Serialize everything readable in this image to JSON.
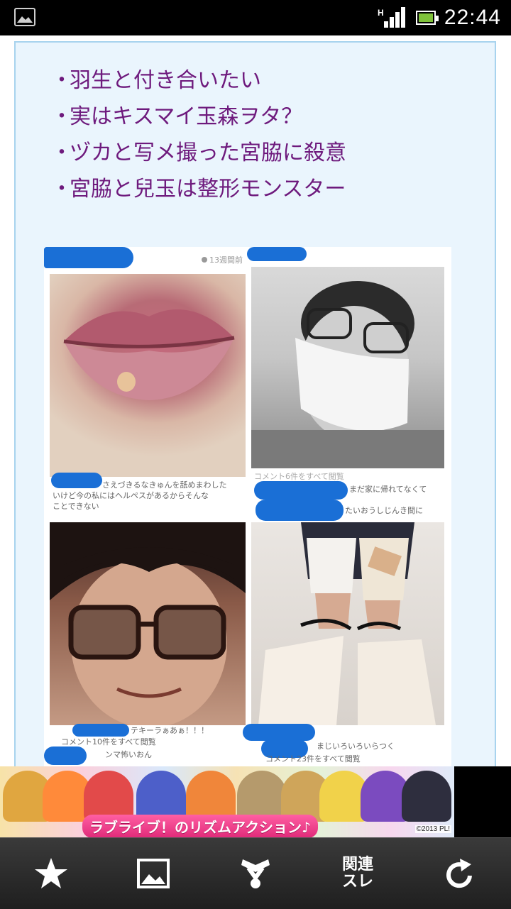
{
  "status_bar": {
    "time": "22:44",
    "network_label": "H"
  },
  "article": {
    "bullets": [
      "羽生と付き合いたい",
      "実はキスマイ玉森ヲタ？",
      "ヅカと写メ撮った宮脇に殺意",
      "宮脇と兒玉は整形モンスター"
    ],
    "bullet_mark": "・"
  },
  "collage": {
    "timestamp": "13週間前",
    "captions": {
      "top_left": [
        "さえづきるなきゅんを舐めまわした",
        "いけど今の私にはヘルペスがあるからそんな",
        "ことできない"
      ],
      "top_right": [
        "コメント6件をすべて閲覧",
        "まだ家に帰れてなくて",
        "たいおうしじんき間に"
      ],
      "bottom_left": [
        "テキーラぁあぁ！！！",
        "コメント10件をすべて閲覧",
        "ンマ怖いおん"
      ],
      "bottom_right": [
        "まじいろいろいらつく",
        "コメント23件をすべて閲覧"
      ]
    }
  },
  "ad": {
    "title": "ラブライブ！のリズムアクション♪",
    "copyright": "©2013 PL!"
  },
  "toolbar": {
    "related_label_1": "関連",
    "related_label_2": "スレ"
  },
  "colors": {
    "bullet_text": "#6e1a7d",
    "panel_bg": "#eaf5fd",
    "panel_border": "#a8d3ee",
    "redaction": "#1a6fd6",
    "toolbar_bg": "#2a2a2a"
  }
}
